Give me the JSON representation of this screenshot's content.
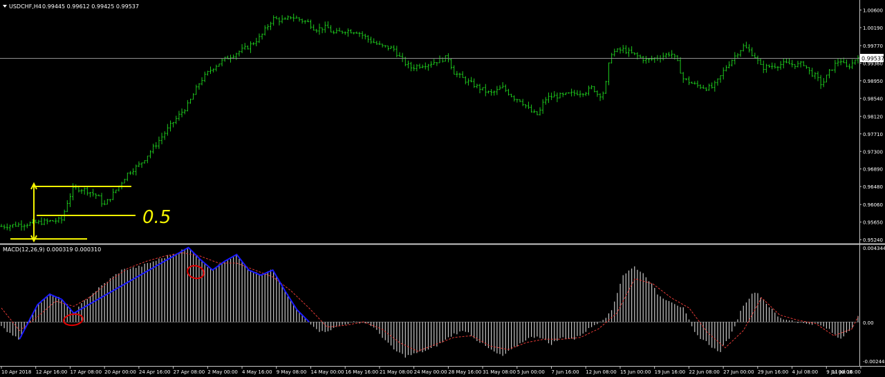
{
  "main_header": {
    "symbol": "USDCHF,H4",
    "ohlc": "0.99445 0.99612 0.99425 0.99537"
  },
  "indicator_header": {
    "label": "MACD(12,26,9) 0.000319 0.000310"
  },
  "annotation": {
    "text": "0.5"
  },
  "colors": {
    "background": "#000000",
    "bars": "#1dc71d",
    "histogram": "#c8c8c8",
    "signal": "#e53935",
    "drawn_blue": "#1a1aff",
    "drawn_yellow": "#f5f500",
    "axis_text": "#ffffff",
    "separator": "#c8c8c8"
  },
  "chart_data": [
    {
      "type": "ohlc",
      "title": "USDCHF,H4",
      "y_ticks": [
        "1.00600",
        "1.00190",
        "0.99770",
        "0.99360",
        "0.98950",
        "0.98540",
        "0.98120",
        "0.97710",
        "0.97300",
        "0.96890",
        "0.96480",
        "0.96060",
        "0.95650",
        "0.95240"
      ],
      "ylim": [
        0.9516,
        1.0077
      ],
      "current_price": "0.99537",
      "x_ticks": [
        "10 Apr 2018",
        "12 Apr 16:00",
        "17 Apr 08:00",
        "20 Apr 00:00",
        "24 Apr 16:00",
        "27 Apr 08:00",
        "2 May 00:00",
        "4 May 16:00",
        "9 May 08:00",
        "14 May 00:00",
        "16 May 16:00",
        "21 May 08:00",
        "24 May 00:00",
        "28 May 16:00",
        "31 May 08:00",
        "5 Jun 00:00",
        "7 Jun 16:00",
        "12 Jun 08:00",
        "15 Jun 00:00",
        "19 Jun 16:00",
        "22 Jun 08:00",
        "27 Jun 00:00",
        "29 Jun 16:00",
        "4 Jul 08:00",
        "9 Jul 00:00",
        "11 Jul 16:00"
      ],
      "close_path": [
        [
          0,
          0.9555
        ],
        [
          5,
          0.9562
        ],
        [
          10,
          0.957
        ],
        [
          11,
          0.9615
        ],
        [
          12,
          0.9645
        ],
        [
          14,
          0.964
        ],
        [
          16,
          0.9625
        ],
        [
          17,
          0.9603
        ],
        [
          19,
          0.964
        ],
        [
          21,
          0.968
        ],
        [
          23,
          0.97
        ],
        [
          25,
          0.9735
        ],
        [
          28,
          0.979
        ],
        [
          31,
          0.984
        ],
        [
          33,
          0.9895
        ],
        [
          35,
          0.9925
        ],
        [
          37,
          0.9945
        ],
        [
          39,
          0.996
        ],
        [
          41,
          0.9975
        ],
        [
          43,
          0.9998
        ],
        [
          44,
          1.002
        ],
        [
          45,
          1.004
        ],
        [
          47,
          1.0035
        ],
        [
          48,
          1.0045
        ],
        [
          49,
          1.004
        ],
        [
          51,
          1.003
        ],
        [
          52,
          1.0015
        ],
        [
          54,
          1.002
        ],
        [
          55,
          1.0005
        ],
        [
          57,
          1.0012
        ],
        [
          59,
          1.001
        ],
        [
          61,
          0.999
        ],
        [
          63,
          0.9975
        ],
        [
          65,
          0.997
        ],
        [
          66,
          0.995
        ],
        [
          67,
          0.9935
        ],
        [
          68,
          0.9925
        ],
        [
          69,
          0.993
        ],
        [
          71,
          0.9935
        ],
        [
          72,
          0.994
        ],
        [
          74,
          0.995
        ],
        [
          75,
          0.9915
        ],
        [
          77,
          0.9895
        ],
        [
          79,
          0.988
        ],
        [
          81,
          0.9865
        ],
        [
          82,
          0.987
        ],
        [
          83,
          0.988
        ],
        [
          85,
          0.9855
        ],
        [
          86,
          0.985
        ],
        [
          87,
          0.9835
        ],
        [
          88,
          0.982
        ],
        [
          89,
          0.9815
        ],
        [
          90,
          0.985
        ],
        [
          91,
          0.9858
        ],
        [
          93,
          0.986
        ],
        [
          95,
          0.9866
        ],
        [
          97,
          0.987
        ],
        [
          98,
          0.988
        ],
        [
          99,
          0.986
        ],
        [
          100,
          0.987
        ],
        [
          101,
          0.996
        ],
        [
          103,
          0.9968
        ],
        [
          105,
          0.9955
        ],
        [
          107,
          0.9942
        ],
        [
          109,
          0.995
        ],
        [
          111,
          0.996
        ],
        [
          112,
          0.994
        ],
        [
          113,
          0.99
        ],
        [
          115,
          0.9885
        ],
        [
          117,
          0.9878
        ],
        [
          118,
          0.988
        ],
        [
          119,
          0.99
        ],
        [
          120,
          0.9925
        ],
        [
          122,
          0.996
        ],
        [
          123,
          0.9975
        ],
        [
          124,
          0.9965
        ],
        [
          125,
          0.995
        ],
        [
          126,
          0.9925
        ],
        [
          128,
          0.993
        ],
        [
          130,
          0.9935
        ],
        [
          132,
          0.9932
        ],
        [
          133,
          0.9935
        ],
        [
          134,
          0.9915
        ],
        [
          135,
          0.9905
        ],
        [
          136,
          0.9885
        ],
        [
          137,
          0.991
        ],
        [
          138,
          0.993
        ],
        [
          139,
          0.9945
        ],
        [
          140,
          0.9925
        ],
        [
          141,
          0.9935
        ],
        [
          142,
          0.9954
        ]
      ]
    },
    {
      "type": "histogram+line",
      "title": "MACD(12,26,9) 0.000319 0.000310",
      "y_ticks": [
        "0.004344",
        "0.00",
        "-0.002446"
      ],
      "ylim": [
        -0.00255,
        0.0044
      ],
      "macd_path": [
        [
          0,
          -0.0003
        ],
        [
          3,
          -0.001
        ],
        [
          6,
          0.001
        ],
        [
          8,
          0.0016
        ],
        [
          10,
          0.0013
        ],
        [
          12,
          0.0005
        ],
        [
          14,
          0.0013
        ],
        [
          17,
          0.0022
        ],
        [
          20,
          0.003
        ],
        [
          23,
          0.0032
        ],
        [
          26,
          0.0036
        ],
        [
          29,
          0.004
        ],
        [
          31,
          0.0043
        ],
        [
          33,
          0.0036
        ],
        [
          35,
          0.003
        ],
        [
          37,
          0.0035
        ],
        [
          39,
          0.0039
        ],
        [
          41,
          0.003
        ],
        [
          43,
          0.0027
        ],
        [
          45,
          0.003
        ],
        [
          47,
          0.0018
        ],
        [
          49,
          0.0007
        ],
        [
          51,
          0.0
        ],
        [
          53,
          -0.0006
        ],
        [
          55,
          -0.0004
        ],
        [
          57,
          -0.0001
        ],
        [
          59,
          0.0
        ],
        [
          61,
          -0.0001
        ],
        [
          63,
          -0.0008
        ],
        [
          65,
          -0.0016
        ],
        [
          67,
          -0.002
        ],
        [
          69,
          -0.0018
        ],
        [
          71,
          -0.0016
        ],
        [
          73,
          -0.0012
        ],
        [
          75,
          -0.0007
        ],
        [
          77,
          -0.0005
        ],
        [
          79,
          -0.0011
        ],
        [
          81,
          -0.0016
        ],
        [
          83,
          -0.002
        ],
        [
          85,
          -0.0015
        ],
        [
          87,
          -0.001
        ],
        [
          89,
          -0.0008
        ],
        [
          91,
          -0.0013
        ],
        [
          93,
          -0.0009
        ],
        [
          95,
          -0.001
        ],
        [
          97,
          -0.0005
        ],
        [
          99,
          0.0
        ],
        [
          101,
          0.0005
        ],
        [
          103,
          0.0027
        ],
        [
          105,
          0.0032
        ],
        [
          107,
          0.0026
        ],
        [
          109,
          0.0015
        ],
        [
          111,
          0.0012
        ],
        [
          113,
          0.0008
        ],
        [
          115,
          -0.0007
        ],
        [
          117,
          -0.0012
        ],
        [
          119,
          -0.0018
        ],
        [
          121,
          -0.0007
        ],
        [
          123,
          0.001
        ],
        [
          125,
          0.0018
        ],
        [
          127,
          0.001
        ],
        [
          129,
          0.0002
        ],
        [
          131,
          0.0001
        ],
        [
          133,
          -0.0001
        ],
        [
          135,
          -0.0001
        ],
        [
          137,
          -0.0004
        ],
        [
          139,
          -0.001
        ],
        [
          141,
          -0.0003
        ],
        [
          142,
          0.0003
        ]
      ],
      "signal_path": [
        [
          0,
          0.0008
        ],
        [
          3,
          -0.0005
        ],
        [
          6,
          0.0003
        ],
        [
          9,
          0.0012
        ],
        [
          12,
          0.0009
        ],
        [
          15,
          0.0015
        ],
        [
          18,
          0.0024
        ],
        [
          21,
          0.0031
        ],
        [
          24,
          0.0035
        ],
        [
          27,
          0.0038
        ],
        [
          30,
          0.004
        ],
        [
          33,
          0.0038
        ],
        [
          36,
          0.0034
        ],
        [
          39,
          0.0034
        ],
        [
          42,
          0.003
        ],
        [
          45,
          0.0026
        ],
        [
          48,
          0.0018
        ],
        [
          51,
          0.0008
        ],
        [
          54,
          -0.0003
        ],
        [
          57,
          -0.0002
        ],
        [
          60,
          0.0
        ],
        [
          63,
          -0.0004
        ],
        [
          66,
          -0.0012
        ],
        [
          69,
          -0.0017
        ],
        [
          72,
          -0.0013
        ],
        [
          75,
          -0.0009
        ],
        [
          78,
          -0.0008
        ],
        [
          81,
          -0.0014
        ],
        [
          84,
          -0.0016
        ],
        [
          87,
          -0.0012
        ],
        [
          90,
          -0.001
        ],
        [
          93,
          -0.001
        ],
        [
          96,
          -0.0009
        ],
        [
          99,
          -0.0004
        ],
        [
          102,
          0.0005
        ],
        [
          105,
          0.0025
        ],
        [
          108,
          0.0022
        ],
        [
          111,
          0.0014
        ],
        [
          114,
          0.0008
        ],
        [
          117,
          -0.0006
        ],
        [
          120,
          -0.0015
        ],
        [
          123,
          -0.0005
        ],
        [
          126,
          0.0014
        ],
        [
          129,
          0.0004
        ],
        [
          132,
          0.0001
        ],
        [
          135,
          -0.0001
        ],
        [
          138,
          -0.0008
        ],
        [
          141,
          -0.0004
        ],
        [
          142,
          0.0003
        ]
      ]
    }
  ]
}
